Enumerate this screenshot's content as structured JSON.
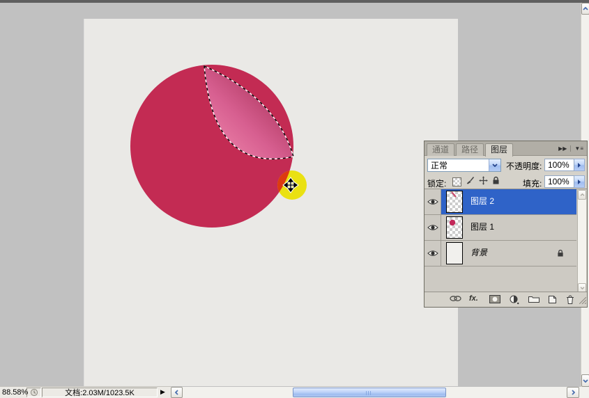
{
  "canvas": {
    "circle_fill": "#c32b53",
    "crescent_light": "#ee85ab",
    "crescent_dark": "#a73057",
    "yellow_fill": "#eae112",
    "overlap_fill": "#dd3a10"
  },
  "layers_panel": {
    "tabs": [
      {
        "label": "通道"
      },
      {
        "label": "路径"
      },
      {
        "label": "图层"
      }
    ],
    "header_icons": {
      "collapse": "▶▶",
      "menu": "▼≡"
    },
    "blend_mode_value": "正常",
    "opacity_label": "不透明度:",
    "opacity_value": "100%",
    "lock_label": "锁定:",
    "fill_label": "填充:",
    "fill_value": "100%",
    "fx_icon_label": "fx.",
    "layers": [
      {
        "name": "图层 2",
        "selected": true
      },
      {
        "name": "图层 1",
        "selected": false
      },
      {
        "name": "背景",
        "selected": false,
        "locked": true
      }
    ]
  },
  "status_bar": {
    "zoom_level": "88.58%",
    "document_info": "文档:2.03M/1023.5K",
    "flyout_arrow": "▶"
  }
}
